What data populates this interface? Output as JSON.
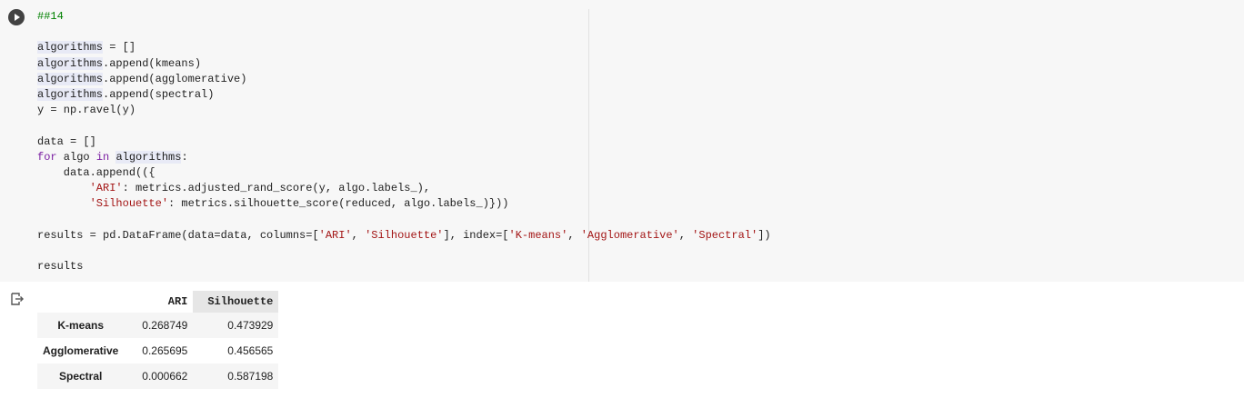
{
  "cell": {
    "code_lines": [
      [
        {
          "t": "##14",
          "c": "comment"
        }
      ],
      [],
      [
        {
          "t": "algorithms",
          "c": "hl"
        },
        {
          "t": " = []"
        }
      ],
      [
        {
          "t": "algorithms",
          "c": "hl"
        },
        {
          "t": ".append(kmeans)"
        }
      ],
      [
        {
          "t": "algorithms",
          "c": "hl"
        },
        {
          "t": ".append(agglomerative)"
        }
      ],
      [
        {
          "t": "algorithms",
          "c": "hl"
        },
        {
          "t": ".append(spectral)"
        }
      ],
      [
        {
          "t": "y = np.ravel(y)"
        }
      ],
      [],
      [
        {
          "t": "data = []"
        }
      ],
      [
        {
          "t": "for",
          "c": "keyword"
        },
        {
          "t": " algo "
        },
        {
          "t": "in",
          "c": "keyword"
        },
        {
          "t": " "
        },
        {
          "t": "algorithms",
          "c": "hl"
        },
        {
          "t": ":"
        }
      ],
      [
        {
          "t": "    data.append(({"
        }
      ],
      [
        {
          "t": "        "
        },
        {
          "t": "'ARI'",
          "c": "string"
        },
        {
          "t": ": metrics.adjusted_rand_score(y, algo.labels_),"
        }
      ],
      [
        {
          "t": "        "
        },
        {
          "t": "'Silhouette'",
          "c": "string"
        },
        {
          "t": ": metrics.silhouette_score(reduced, algo.labels_)}))"
        }
      ],
      [],
      [
        {
          "t": "results = pd.DataFrame(data=data, columns=["
        },
        {
          "t": "'ARI'",
          "c": "string"
        },
        {
          "t": ", "
        },
        {
          "t": "'Silhouette'",
          "c": "string"
        },
        {
          "t": "], index=["
        },
        {
          "t": "'K-means'",
          "c": "string"
        },
        {
          "t": ", "
        },
        {
          "t": "'Agglomerative'",
          "c": "string"
        },
        {
          "t": ", "
        },
        {
          "t": "'Spectral'",
          "c": "string"
        },
        {
          "t": "])"
        }
      ],
      [],
      [
        {
          "t": "results"
        }
      ]
    ]
  },
  "output": {
    "table": {
      "columns": [
        "",
        "ARI",
        "Silhouette"
      ],
      "rows": [
        {
          "index": "K-means",
          "ari": "0.268749",
          "silhouette": "0.473929"
        },
        {
          "index": "Agglomerative",
          "ari": "0.265695",
          "silhouette": "0.456565"
        },
        {
          "index": "Spectral",
          "ari": "0.000662",
          "silhouette": "0.587198"
        }
      ]
    }
  },
  "icons": {
    "run": "play-circle-icon",
    "output": "output-redirect-icon"
  },
  "colors": {
    "comment": "#008000",
    "keyword": "#7b1fa2",
    "string": "#a31515",
    "highlight": "#e8eaf6",
    "run_button": "#424242"
  }
}
